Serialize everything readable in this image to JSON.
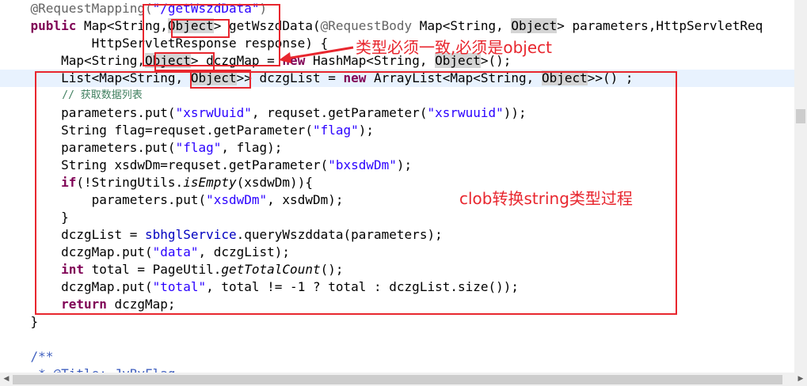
{
  "code": {
    "l1_annotation": "@RequestMapping(",
    "l1_path": "\"/getWszdData\"",
    "l1_close": ")",
    "l2_public": "public",
    "l2_a": " Map<String,",
    "l2_object1": "Object",
    "l2_b": "> getWszdData(",
    "l2_reqbody": "@RequestBody",
    "l2_c": " Map<String, ",
    "l2_object2": "Object",
    "l2_d": "> parameters,HttpServletReq",
    "l3": "HttpServletResponse response) {",
    "l4_a": "Map<String,",
    "l4_object1": "Object",
    "l4_b": "> dczgMap = ",
    "l4_new": "new",
    "l4_c": " HashMap<String, ",
    "l4_object2": "Object",
    "l4_d": ">();",
    "l5_a": "List<Map<String, ",
    "l5_object1": "Object",
    "l5_b": ">> dczgList = ",
    "l5_new": "new",
    "l5_c": " ArrayList<Map<String, ",
    "l5_object2": "Object",
    "l5_d": ">>() ;",
    "l6_comment": "// 获取数据列表",
    "l7_a": "parameters.put(",
    "l7_s1": "\"xsrwUuid\"",
    "l7_b": ", requset.getParameter(",
    "l7_s2": "\"xsrwuuid\"",
    "l7_c": "));",
    "l8_a": "String flag=requset.getParameter(",
    "l8_s": "\"flag\"",
    "l8_b": ");",
    "l9_a": "parameters.put(",
    "l9_s": "\"flag\"",
    "l9_b": ", flag);",
    "l10_a": "String xsdwDm=requset.getParameter(",
    "l10_s": "\"bxsdwDm\"",
    "l10_b": ");",
    "l11_if": "if",
    "l11_a": "(!StringUtils.",
    "l11_method": "isEmpty",
    "l11_b": "(xsdwDm)){",
    "l12_a": "parameters.put(",
    "l12_s": "\"xsdwDm\"",
    "l12_b": ", xsdwDm);",
    "l13": "}",
    "l14_a": "dczgList = ",
    "l14_field": "sbhglService",
    "l14_b": ".queryWszddata(parameters);",
    "l15_a": "dczgMap.put(",
    "l15_s": "\"data\"",
    "l15_b": ", dczgList);",
    "l16_int": "int",
    "l16_a": " total = PageUtil.",
    "l16_method": "getTotalCount",
    "l16_b": "();",
    "l17_a": "dczgMap.put(",
    "l17_s": "\"total\"",
    "l17_b": ", total != -1 ? total : dczgList.size());",
    "l18_return": "return",
    "l18_a": " dczgMap;",
    "l19": "}",
    "l21_javadoc": "/**",
    "l22_javadoc": " * @Title: JyByFlag"
  },
  "annotations": {
    "type_note": "类型必须一致,必须是object",
    "clob_note": "clob转换string类型过程"
  },
  "colors": {
    "keyword": "#7f0055",
    "string": "#2a00ff",
    "annotation_text": "#646464",
    "comment": "#3f7f5f",
    "red_marker": "#e8262e"
  }
}
